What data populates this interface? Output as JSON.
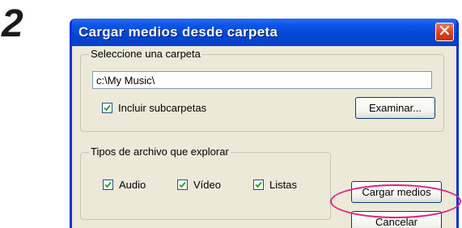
{
  "step": {
    "number": "2"
  },
  "dialog": {
    "title": "Cargar medios desde carpeta",
    "close_icon": "close-icon",
    "folder_group": {
      "legend": "Seleccione una carpeta",
      "path_value": "c:\\My Music\\",
      "include_subfolders": {
        "label": "Incluir subcarpetas",
        "checked": true
      },
      "browse_label": "Examinar..."
    },
    "types_group": {
      "legend": "Tipos de archivo que explorar",
      "options": [
        {
          "label": "Audio",
          "checked": true
        },
        {
          "label": "Vídeo",
          "checked": true
        },
        {
          "label": "Listas",
          "checked": true
        }
      ]
    },
    "load_label": "Cargar medios",
    "cancel_label": "Cancelar"
  },
  "annotation": {
    "highlight_target": "cancel-button",
    "highlight_color": "#e0207c"
  }
}
